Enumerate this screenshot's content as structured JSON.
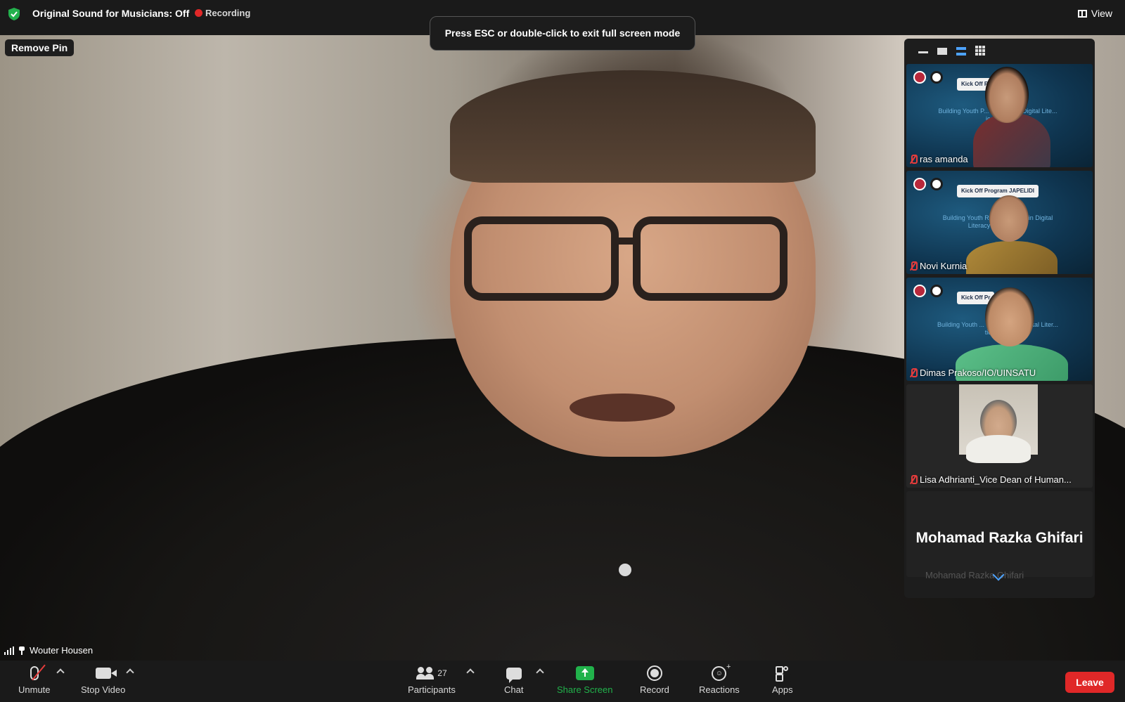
{
  "topbar": {
    "original_sound_label": "Original Sound for Musicians: Off",
    "recording_label": "Recording",
    "view_label": "View"
  },
  "toast": {
    "message": "Press ESC or double-click to exit full screen mode"
  },
  "main": {
    "remove_pin_label": "Remove Pin",
    "speaker_name": "Wouter Housen"
  },
  "gallery": {
    "tiles": [
      {
        "name": "ras amanda",
        "slide_title": "Kick Off P",
        "slide_sub": "Building Youth P... icipation in Digital Lite... ical Year"
      },
      {
        "name": "Novi Kurnia",
        "slide_title": "Kick Off Program JAPELIDI",
        "slide_sub": "Building Youth Re... rticipation in Digital Literacy ... litical Year"
      },
      {
        "name": "Dimas Prakoso/IO/UINSATU",
        "slide_title": "Kick Off Pr",
        "slide_sub": "Building Youth ... rticipation in Digital Liter... tical Year"
      },
      {
        "name": "Lisa Adhrianti_Vice Dean of Human..."
      },
      {
        "name": "Mohamad Razka Ghifari",
        "faded_label": "Mohamad Razka Ghifari"
      }
    ]
  },
  "toolbar": {
    "unmute_label": "Unmute",
    "stop_video_label": "Stop Video",
    "participants_label": "Participants",
    "participants_count": "27",
    "chat_label": "Chat",
    "share_screen_label": "Share Screen",
    "record_label": "Record",
    "reactions_label": "Reactions",
    "apps_label": "Apps",
    "leave_label": "Leave"
  },
  "colors": {
    "share_green": "#21b24b",
    "leave_red": "#e02828",
    "recording_red": "#e02828",
    "accent_blue": "#4da3ff"
  },
  "icons": [
    "shield-icon",
    "recording-dot-icon",
    "view-icon",
    "signal-icon",
    "pin-icon",
    "mic-muted-icon",
    "video-camera-icon",
    "participants-icon",
    "chat-icon",
    "share-screen-icon",
    "record-icon",
    "reactions-icon",
    "apps-icon",
    "chevron-down-icon"
  ]
}
